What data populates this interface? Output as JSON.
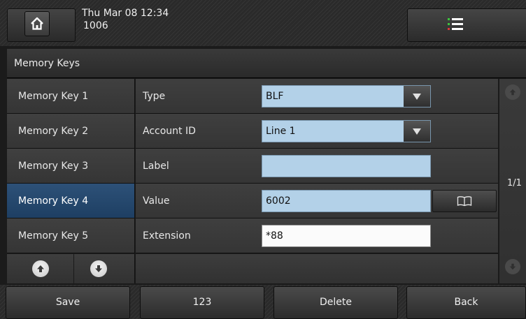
{
  "status": {
    "datetime": "Thu Mar 08 12:34",
    "extension": "1006"
  },
  "title": "Memory Keys",
  "key_list": [
    {
      "label": "Memory Key 1",
      "selected": false
    },
    {
      "label": "Memory Key 2",
      "selected": false
    },
    {
      "label": "Memory Key 3",
      "selected": false
    },
    {
      "label": "Memory Key 4",
      "selected": true
    },
    {
      "label": "Memory Key 5",
      "selected": false
    }
  ],
  "form": {
    "type": {
      "label": "Type",
      "value": "BLF"
    },
    "account": {
      "label": "Account ID",
      "value": "Line 1"
    },
    "label_field": {
      "label": "Label",
      "value": ""
    },
    "value_field": {
      "label": "Value",
      "value": "6002"
    },
    "extension": {
      "label": "Extension",
      "value": "*88"
    }
  },
  "pager": {
    "page": "1/1"
  },
  "softkeys": {
    "save": "Save",
    "input_mode": "123",
    "delete": "Delete",
    "back": "Back"
  },
  "icons": {
    "home": "home-icon",
    "menu": "menu-list-icon",
    "directory": "book-icon",
    "up": "arrow-up-icon",
    "down": "arrow-down-icon"
  },
  "colors": {
    "selected": "#2d5178",
    "field": "#b3d1e8",
    "menu_dot_green": "#3ec43e",
    "menu_dot_red": "#d83a3a"
  }
}
